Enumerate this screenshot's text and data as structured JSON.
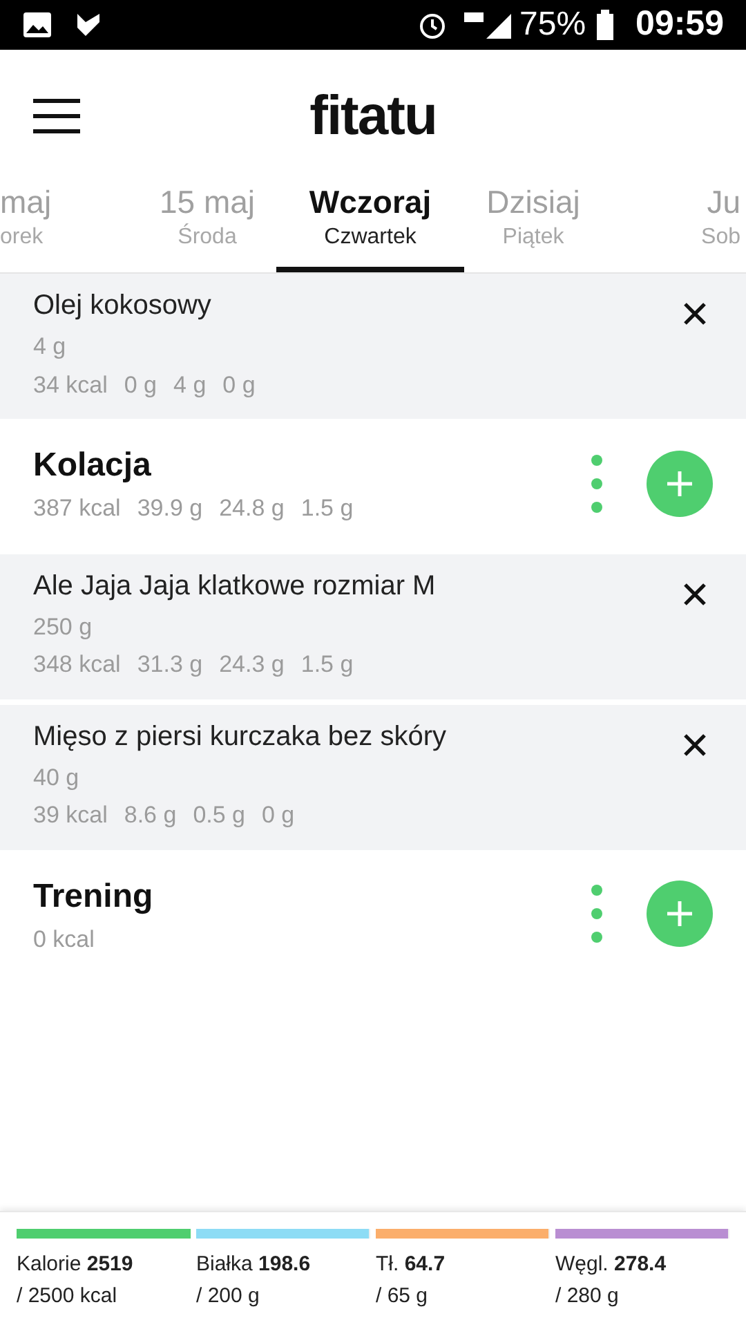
{
  "status_bar": {
    "battery": "75%",
    "time": "09:59"
  },
  "header": {
    "logo": "fitatu"
  },
  "date_tabs": [
    {
      "date": "maj",
      "day": "orek",
      "selected": false
    },
    {
      "date": "15 maj",
      "day": "Środa",
      "selected": false
    },
    {
      "date": "Wczoraj",
      "day": "Czwartek",
      "selected": true
    },
    {
      "date": "Dzisiaj",
      "day": "Piątek",
      "selected": false
    },
    {
      "date": "Ju",
      "day": "Sob",
      "selected": false
    }
  ],
  "entries": [
    {
      "kind": "food",
      "name": "Olej kokosowy",
      "amount": "4 g",
      "values": [
        "34 kcal",
        "0 g",
        "4 g",
        "0 g"
      ]
    },
    {
      "kind": "meal",
      "name": "Kolacja",
      "values": [
        "387 kcal",
        "39.9 g",
        "24.8 g",
        "1.5 g"
      ]
    },
    {
      "kind": "food",
      "name": "Ale Jaja Jaja klatkowe rozmiar M",
      "amount": "250 g",
      "values": [
        "348 kcal",
        "31.3 g",
        "24.3 g",
        "1.5 g"
      ]
    },
    {
      "kind": "food",
      "name": "Mięso z piersi kurczaka bez skóry",
      "amount": "40 g",
      "values": [
        "39 kcal",
        "8.6 g",
        "0.5 g",
        "0 g"
      ]
    },
    {
      "kind": "meal",
      "name": "Trening",
      "values": [
        "0 kcal"
      ]
    }
  ],
  "summary": [
    {
      "label": "Kalorie",
      "value": "2519",
      "goal": "/ 2500 kcal",
      "level": 1,
      "color": "#4fce6f"
    },
    {
      "label": "Białka",
      "value": "198.6",
      "goal": "/ 200 g",
      "level": 0.993,
      "color": "#8ddcf5"
    },
    {
      "label": "Tł.",
      "value": "64.7",
      "goal": "/ 65 g",
      "level": 0.995,
      "color": "#fbae6b"
    },
    {
      "label": "Węgl.",
      "value": "278.4",
      "goal": "/ 280 g",
      "level": 0.994,
      "color": "#b98ed2"
    }
  ]
}
